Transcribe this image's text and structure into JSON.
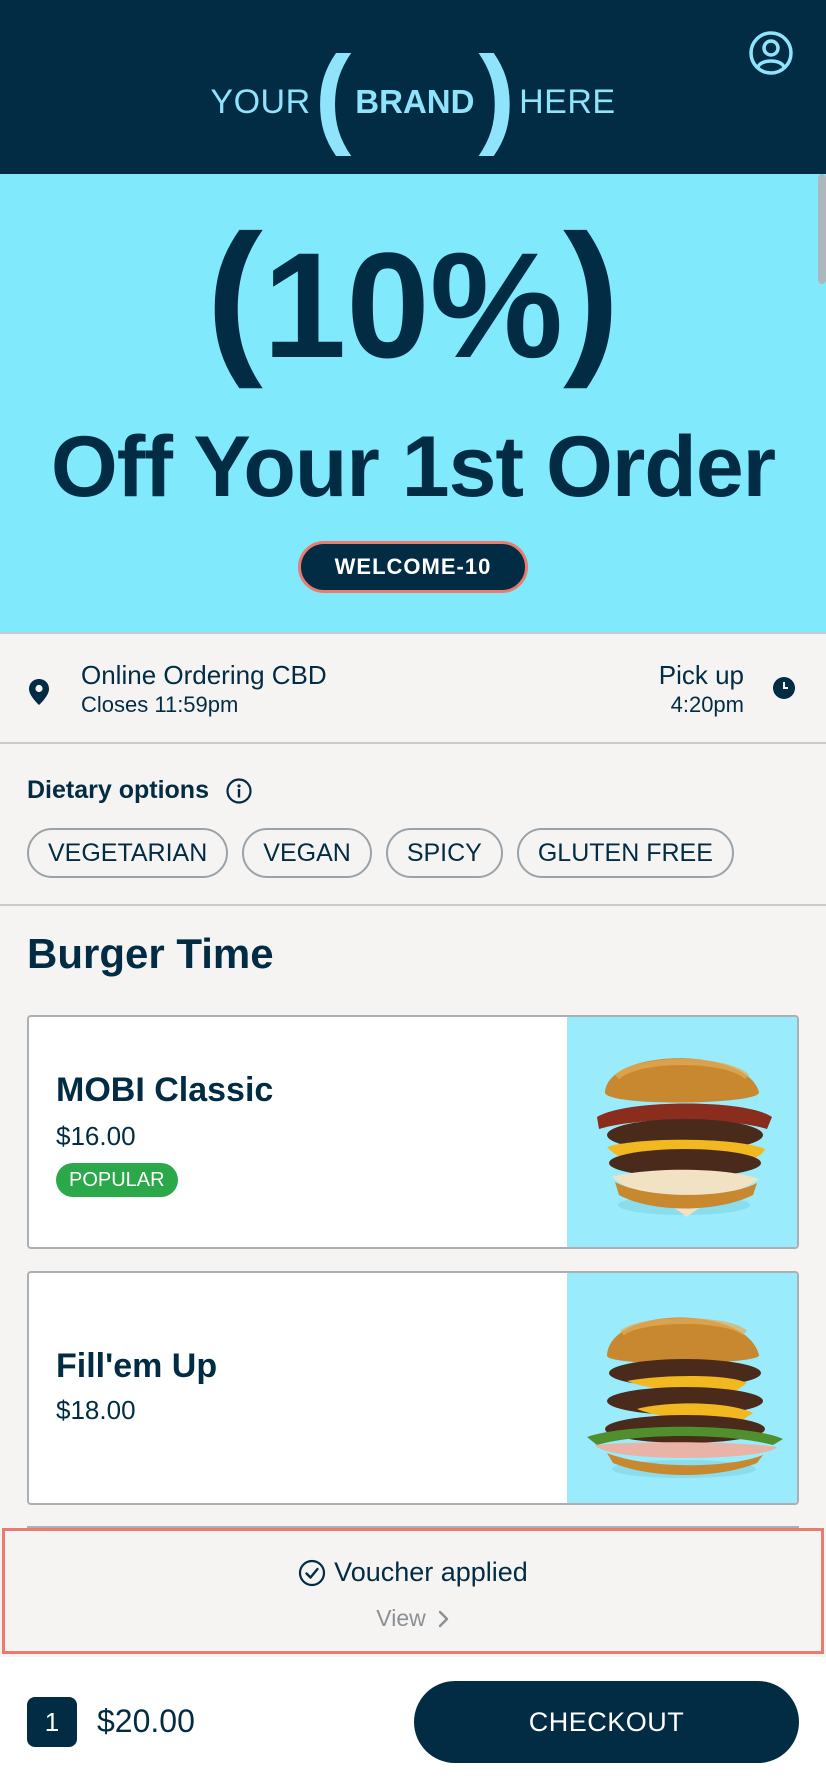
{
  "header": {
    "logo_left": "YOUR",
    "logo_brand": "BRAND",
    "logo_right": "HERE",
    "icon": "account-icon"
  },
  "promo": {
    "amount": "10%",
    "headline": "Off Your 1st Order",
    "code": "WELCOME-10"
  },
  "location": {
    "name": "Online Ordering CBD",
    "hours": "Closes 11:59pm",
    "pickup_label": "Pick up",
    "pickup_time": "4:20pm",
    "icons": [
      "map-pin-icon",
      "clock-icon"
    ]
  },
  "dietary": {
    "title": "Dietary options",
    "filters": [
      "VEGETARIAN",
      "VEGAN",
      "SPICY",
      "GLUTEN FREE"
    ]
  },
  "menu": {
    "category": "Burger Time",
    "items": [
      {
        "name": "MOBI Classic",
        "price": "$16.00",
        "badge": "POPULAR"
      },
      {
        "name": "Fill'em Up",
        "price": "$18.00"
      }
    ]
  },
  "voucher": {
    "status": "Voucher applied",
    "link": "View"
  },
  "cart": {
    "quantity": "1",
    "total": "$20.00",
    "checkout_label": "CHECKOUT"
  },
  "colors": {
    "navy": "#022c43",
    "cyan": "#80e9fb",
    "coral": "#ea7b6f",
    "green": "#2aa84a"
  }
}
